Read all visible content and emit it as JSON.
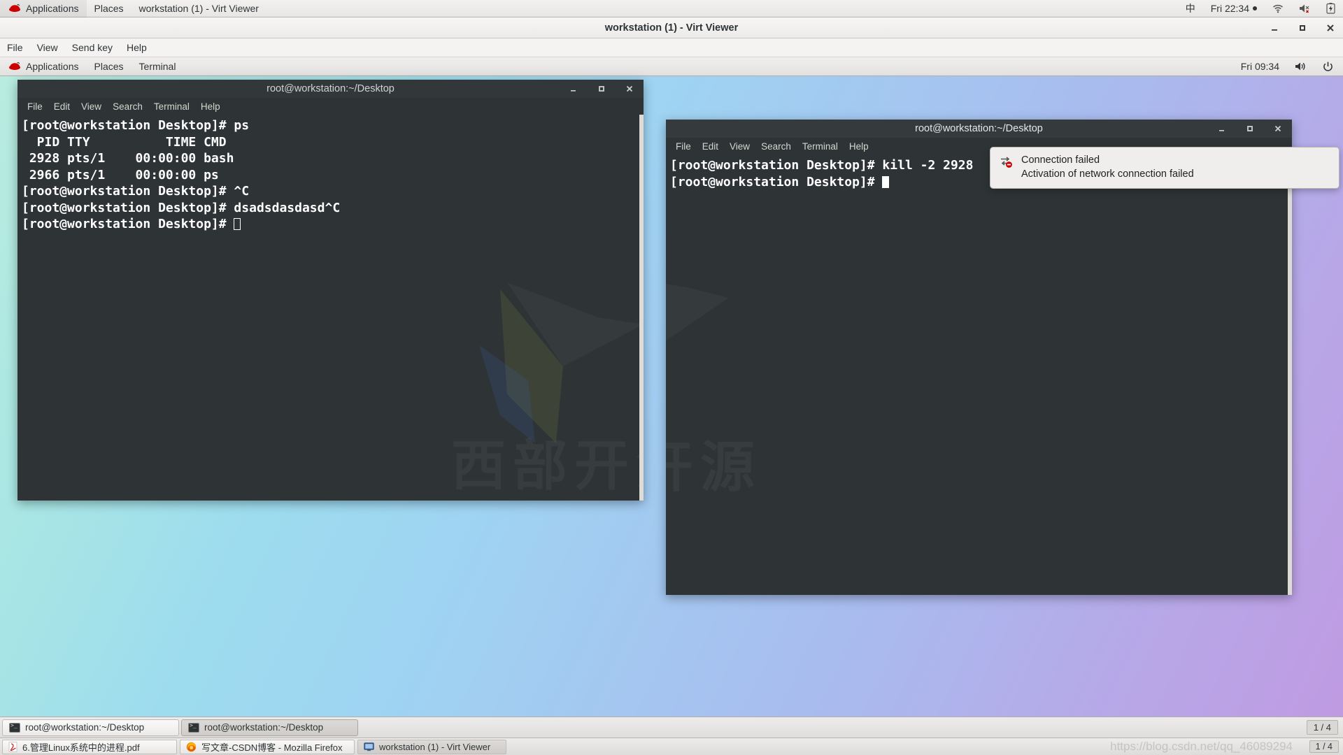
{
  "host": {
    "panel": {
      "applications_label": "Applications",
      "places_label": "Places",
      "window_label": "workstation (1) - Virt Viewer",
      "input_method": "中",
      "clock": "Fri 22:34",
      "logo_icon": "redhat-logo-icon",
      "wifi_icon": "wifi-icon",
      "volume_icon": "volume-muted-icon",
      "battery_icon": "battery-charging-icon"
    },
    "taskbar": {
      "items": [
        {
          "label": "6.管理Linux系统中的进程.pdf",
          "icon": "pdf-icon",
          "active": false
        },
        {
          "label": "写文章-CSDN博客 - Mozilla Firefox",
          "icon": "firefox-icon",
          "active": false
        },
        {
          "label": "workstation (1) - Virt Viewer",
          "icon": "display-icon",
          "active": true
        }
      ],
      "pager": "1 / 4"
    },
    "watermark_url": "https://blog.csdn.net/qq_46089294"
  },
  "virt_viewer": {
    "title": "workstation (1) - Virt Viewer",
    "menu": [
      "File",
      "View",
      "Send key",
      "Help"
    ],
    "window_controls": {
      "minimize_icon": "minimize-icon",
      "maximize_icon": "maximize-icon",
      "close_icon": "close-icon"
    }
  },
  "guest": {
    "panel": {
      "applications_label": "Applications",
      "places_label": "Places",
      "window_label": "Terminal",
      "clock": "Fri 09:34",
      "logo_icon": "redhat-logo-icon",
      "volume_icon": "volume-icon",
      "power_icon": "power-icon"
    },
    "terminals": [
      {
        "title": "root@workstation:~/Desktop",
        "menu": [
          "File",
          "Edit",
          "View",
          "Search",
          "Terminal",
          "Help"
        ],
        "window_controls": {
          "minimize": "_",
          "maximize": "□",
          "close": "✕"
        },
        "lines": [
          "[root@workstation Desktop]# ps",
          "  PID TTY          TIME CMD",
          " 2928 pts/1    00:00:00 bash",
          " 2966 pts/1    00:00:00 ps",
          "[root@workstation Desktop]# ^C",
          "[root@workstation Desktop]# dsadsdasdasd^C",
          "[root@workstation Desktop]# "
        ],
        "watermark": "西部开源"
      },
      {
        "title": "root@workstation:~/Desktop",
        "menu": [
          "File",
          "Edit",
          "View",
          "Search",
          "Terminal",
          "Help"
        ],
        "window_controls": {
          "minimize": "_",
          "maximize": "□",
          "close": "✕"
        },
        "lines": [
          "[root@workstation Desktop]# kill -2 2928",
          "[root@workstation Desktop]# "
        ],
        "watermark": "西部开源"
      }
    ],
    "notification": {
      "icon": "network-error-icon",
      "title": "Connection failed",
      "text": "Activation of network connection failed"
    },
    "taskbar": {
      "items": [
        {
          "label": "root@workstation:~/Desktop",
          "icon": "terminal-icon",
          "active": false
        },
        {
          "label": "root@workstation:~/Desktop",
          "icon": "terminal-icon",
          "active": true
        }
      ],
      "pager": "1 / 4"
    }
  },
  "colors": {
    "terminal_bg": "#2e3436",
    "terminal_fg": "#ffffff",
    "panel_bg": "#eceae8",
    "accent_red": "#cc0000"
  }
}
